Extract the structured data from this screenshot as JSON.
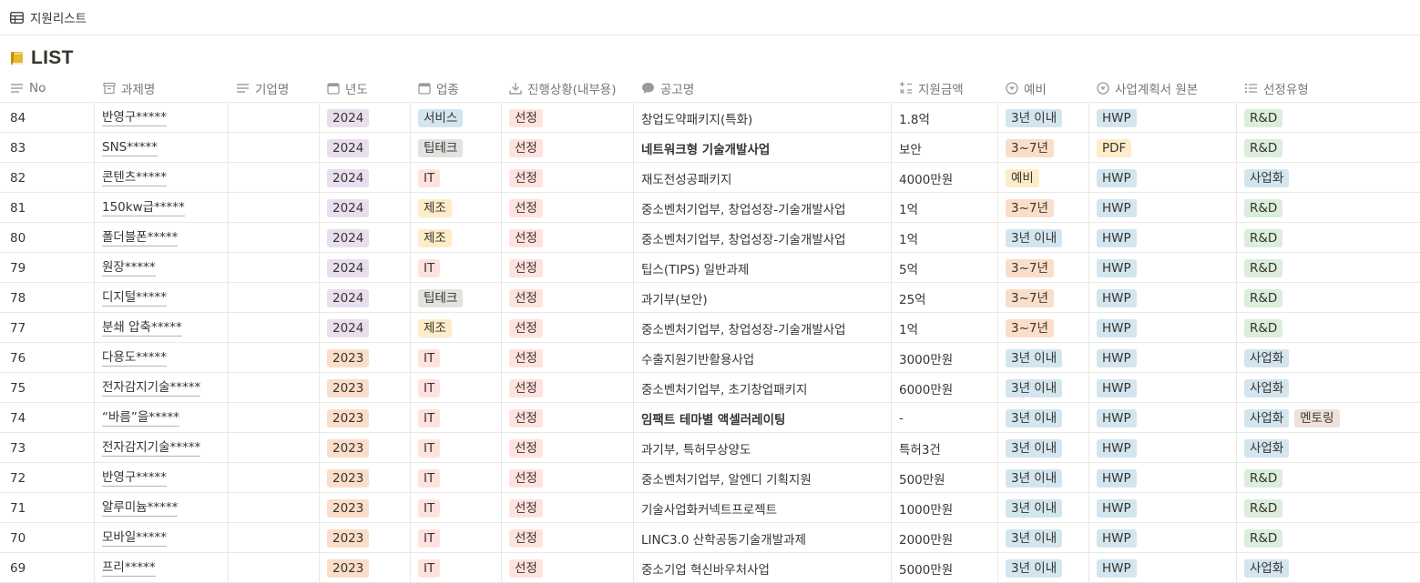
{
  "view": {
    "tab_label": "지원리스트"
  },
  "page": {
    "title": "LIST"
  },
  "columns": [
    {
      "key": "no",
      "label": "No",
      "icon": "lines-icon"
    },
    {
      "key": "name",
      "label": "과제명",
      "icon": "box-icon"
    },
    {
      "key": "company",
      "label": "기업명",
      "icon": "text-icon"
    },
    {
      "key": "year",
      "label": "년도",
      "icon": "calendar-icon"
    },
    {
      "key": "industry",
      "label": "업종",
      "icon": "calendar-icon"
    },
    {
      "key": "status",
      "label": "진행상황(내부용)",
      "icon": "download-icon"
    },
    {
      "key": "notice",
      "label": "공고명",
      "icon": "speech-bubble-icon"
    },
    {
      "key": "amount",
      "label": "지원금액",
      "icon": "formula-icon"
    },
    {
      "key": "prelim",
      "label": "예비",
      "icon": "select-icon"
    },
    {
      "key": "plan",
      "label": "사업계획서 원본",
      "icon": "select-icon"
    },
    {
      "key": "type",
      "label": "선정유형",
      "icon": "list-icon"
    }
  ],
  "tag_colors": {
    "purple": "#e8deee",
    "orange": "#fadec9",
    "blue": "#d3e5ef",
    "gray": "#e3e2e0",
    "yellow": "#fdecc8",
    "red": "#ffe2dd",
    "green": "#dbeddb",
    "brown": "#eee0da"
  },
  "rows": [
    {
      "no": "84",
      "name": "반영구*****",
      "year": "2024",
      "industry": "서비스",
      "status": "선정",
      "notice": "창업도약패키지(특화)",
      "notice_bold": false,
      "amount": "1.8억",
      "prelim": "3년 이내",
      "plan": "HWP",
      "types": [
        "R&D"
      ]
    },
    {
      "no": "83",
      "name": "SNS*****",
      "year": "2024",
      "industry": "팁테크",
      "status": "선정",
      "notice": "네트워크형 기술개발사업",
      "notice_bold": true,
      "amount": "보안",
      "prelim": "3~7년",
      "plan": "PDF",
      "types": [
        "R&D"
      ]
    },
    {
      "no": "82",
      "name": "콘텐츠*****",
      "year": "2024",
      "industry": "IT",
      "status": "선정",
      "notice": "재도전성공패키지",
      "notice_bold": false,
      "amount": "4000만원",
      "prelim": "예비",
      "plan": "HWP",
      "types": [
        "사업화"
      ]
    },
    {
      "no": "81",
      "name": "150kw급*****",
      "year": "2024",
      "industry": "제조",
      "status": "선정",
      "notice": "중소벤처기업부, 창업성장-기술개발사업",
      "notice_bold": false,
      "amount": "1억",
      "prelim": "3~7년",
      "plan": "HWP",
      "types": [
        "R&D"
      ]
    },
    {
      "no": "80",
      "name": "폴더블폰*****",
      "year": "2024",
      "industry": "제조",
      "status": "선정",
      "notice": "중소벤처기업부, 창업성장-기술개발사업",
      "notice_bold": false,
      "amount": "1억",
      "prelim": "3년 이내",
      "plan": "HWP",
      "types": [
        "R&D"
      ]
    },
    {
      "no": "79",
      "name": "원장*****",
      "year": "2024",
      "industry": "IT",
      "status": "선정",
      "notice": "팁스(TIPS) 일반과제",
      "notice_bold": false,
      "amount": "5억",
      "prelim": "3~7년",
      "plan": "HWP",
      "types": [
        "R&D"
      ]
    },
    {
      "no": "78",
      "name": "디지털*****",
      "year": "2024",
      "industry": "팁테크",
      "status": "선정",
      "notice": "과기부(보안)",
      "notice_bold": false,
      "amount": "25억",
      "prelim": "3~7년",
      "plan": "HWP",
      "types": [
        "R&D"
      ]
    },
    {
      "no": "77",
      "name": "분쇄 압축*****",
      "year": "2024",
      "industry": "제조",
      "status": "선정",
      "notice": "중소벤처기업부, 창업성장-기술개발사업",
      "notice_bold": false,
      "amount": "1억",
      "prelim": "3~7년",
      "plan": "HWP",
      "types": [
        "R&D"
      ]
    },
    {
      "no": "76",
      "name": "다용도*****",
      "year": "2023",
      "industry": "IT",
      "status": "선정",
      "notice": "수출지원기반활용사업",
      "notice_bold": false,
      "amount": "3000만원",
      "prelim": "3년 이내",
      "plan": "HWP",
      "types": [
        "사업화"
      ]
    },
    {
      "no": "75",
      "name": "전자감지기술*****",
      "year": "2023",
      "industry": "IT",
      "status": "선정",
      "notice": "중소벤처기업부, 초기창업패키지",
      "notice_bold": false,
      "amount": "6000만원",
      "prelim": "3년 이내",
      "plan": "HWP",
      "types": [
        "사업화"
      ]
    },
    {
      "no": "74",
      "name": "“바름”을*****",
      "year": "2023",
      "industry": "IT",
      "status": "선정",
      "notice": "임팩트 테마별 액셀러레이팅",
      "notice_bold": true,
      "amount": "-",
      "prelim": "3년 이내",
      "plan": "HWP",
      "types": [
        "사업화",
        "멘토링"
      ]
    },
    {
      "no": "73",
      "name": "전자감지기술*****",
      "year": "2023",
      "industry": "IT",
      "status": "선정",
      "notice": "과기부, 특허무상양도",
      "notice_bold": false,
      "amount": "특허3건",
      "prelim": "3년 이내",
      "plan": "HWP",
      "types": [
        "사업화"
      ]
    },
    {
      "no": "72",
      "name": "반영구*****",
      "year": "2023",
      "industry": "IT",
      "status": "선정",
      "notice": "중소벤처기업부, 알엔디 기획지원",
      "notice_bold": false,
      "amount": "500만원",
      "prelim": "3년 이내",
      "plan": "HWP",
      "types": [
        "R&D"
      ]
    },
    {
      "no": "71",
      "name": "알루미늄*****",
      "year": "2023",
      "industry": "IT",
      "status": "선정",
      "notice": "기술사업화커넥트프로젝트",
      "notice_bold": false,
      "amount": "1000만원",
      "prelim": "3년 이내",
      "plan": "HWP",
      "types": [
        "R&D"
      ]
    },
    {
      "no": "70",
      "name": "모바일*****",
      "year": "2023",
      "industry": "IT",
      "status": "선정",
      "notice": "LINC3.0 산학공동기술개발과제",
      "notice_bold": false,
      "amount": "2000만원",
      "prelim": "3년 이내",
      "plan": "HWP",
      "types": [
        "R&D"
      ]
    },
    {
      "no": "69",
      "name": "프리*****",
      "year": "2023",
      "industry": "IT",
      "status": "선정",
      "notice": "중소기업 혁신바우처사업",
      "notice_bold": false,
      "amount": "5000만원",
      "prelim": "3년 이내",
      "plan": "HWP",
      "types": [
        "사업화"
      ]
    }
  ]
}
